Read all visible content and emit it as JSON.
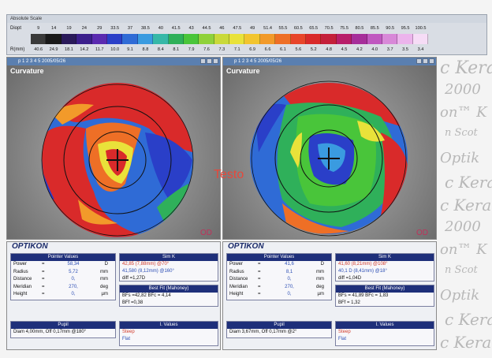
{
  "scale": {
    "title": "Absolute Scale",
    "dioptres_label": "Diopt",
    "radius_label": "R(mm)",
    "dioptres": [
      "9",
      "14",
      "19",
      "24",
      "29",
      "33.5",
      "37",
      "38.5",
      "40",
      "41.5",
      "43",
      "44.5",
      "46",
      "47.5",
      "49",
      "51.4",
      "55.5",
      "60.5",
      "65.5",
      "70.5",
      "75.5",
      "80.5",
      "85.5",
      "90.5",
      "95.5",
      "100.5"
    ],
    "radii": [
      "40.6",
      "24.9",
      "18.1",
      "14.2",
      "11.7",
      "10.0",
      "9.1",
      "8.8",
      "8.4",
      "8.1",
      "7.9",
      "7.6",
      "7.3",
      "7.1",
      "6.9",
      "6.6",
      "6.1",
      "5.6",
      "5.2",
      "4.8",
      "4.5",
      "4.2",
      "4.0",
      "3.7",
      "3.5",
      "3.4"
    ],
    "colors": [
      "#3a3a3a",
      "#1a1a1a",
      "#2a1a5a",
      "#3b1f8c",
      "#5a2ab0",
      "#2a3fc8",
      "#2f6bd6",
      "#3a9be0",
      "#36b8a8",
      "#2fb05a",
      "#49c53a",
      "#8fd13a",
      "#c9d93a",
      "#e9e23a",
      "#f2c52f",
      "#f29a2a",
      "#ee6f26",
      "#e8452a",
      "#d92a2a",
      "#c41f3a",
      "#b81e6a",
      "#a62e9a",
      "#c058c0",
      "#d888d8",
      "#ecb4ec",
      "#f6dcf6"
    ]
  },
  "left_panel": {
    "title": "p 1 2 3 4 5  2005/05/26",
    "map_label": "Curvature",
    "od": "OD",
    "logo": "OPTIKON",
    "pointer": {
      "header": "Pointer Values",
      "rows": [
        {
          "name": "Power",
          "eq": "=",
          "value": "58,34",
          "unit": "D"
        },
        {
          "name": "Radius",
          "eq": "=",
          "value": "5,72",
          "unit": "mm"
        },
        {
          "name": "Distance",
          "eq": "=",
          "value": "0,",
          "unit": "mm"
        },
        {
          "name": "Meridian",
          "eq": "=",
          "value": "270,",
          "unit": "deg"
        },
        {
          "name": "Height",
          "eq": "=",
          "value": "0,",
          "unit": "µm"
        }
      ]
    },
    "simk": {
      "header": "Sim K",
      "line1": "42,85 (7,88mm) @70°",
      "line2": "41,580 (8,12mm) @160°",
      "line3": "diff =1,27D"
    },
    "bestfit": {
      "header": "Best Fit (Mahoney)",
      "line1": "BFs =42,82 BFc = 4,14",
      "line2": "BFf =0,38"
    },
    "pupil": {
      "header": "Pupil",
      "line1": "Diam 4,00mm, Off 0,17mm @180°"
    },
    "values": {
      "header": "I. Values",
      "line1": "Steep",
      "line2": "Flat"
    }
  },
  "right_panel": {
    "title": "p 1 2 3 4 5  2005/05/26",
    "map_label": "Curvature",
    "od": "OD",
    "logo": "OPTIKON",
    "pointer": {
      "header": "Pointer Values",
      "rows": [
        {
          "name": "Power",
          "eq": "=",
          "value": "41,6",
          "unit": "D"
        },
        {
          "name": "Radius",
          "eq": "=",
          "value": "8,1",
          "unit": "mm"
        },
        {
          "name": "Distance",
          "eq": "=",
          "value": "0,",
          "unit": "mm"
        },
        {
          "name": "Meridian",
          "eq": "=",
          "value": "270,",
          "unit": "deg"
        },
        {
          "name": "Height",
          "eq": "=",
          "value": "0,",
          "unit": "µm"
        }
      ]
    },
    "simk": {
      "header": "Sim K",
      "line1": "41,60 (8,21mm) @108°",
      "line2": "40,1 D (8,41mm) @18°",
      "line3": "diff =1,04D"
    },
    "bestfit": {
      "header": "Best Fit (Mahoney)",
      "line1": "BFs = 41,89 BFc = 1,83",
      "line2": "BFf = 1,32"
    },
    "pupil": {
      "header": "Pupil",
      "line1": "Diam 3,67mm, Off 0,17mm @2°"
    },
    "values": {
      "header": "I. Values",
      "line1": "Steep",
      "line2": "Flat"
    }
  },
  "watermark": "Testo",
  "sidebar_text": [
    "c Kera",
    "2000",
    "on™ K",
    "n Scot",
    "Optik",
    "c Kera",
    "c Kera",
    "2000",
    "on™ K",
    "n Scot",
    "Optik",
    "c Kera",
    "c Kera"
  ]
}
